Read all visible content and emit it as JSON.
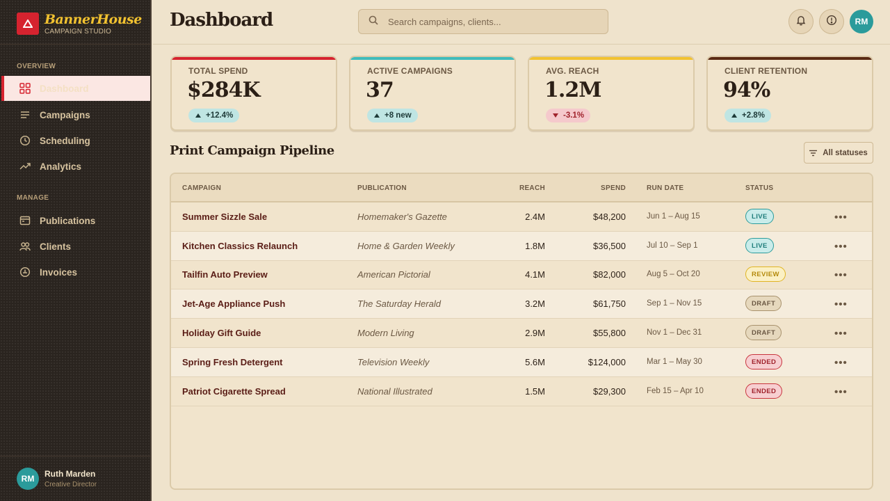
{
  "brand": {
    "name": "BannerHouse",
    "subtitle": "CAMPAIGN STUDIO"
  },
  "sidebar": {
    "sections": [
      {
        "label": "OVERVIEW"
      },
      {
        "label": "MANAGE"
      }
    ],
    "overview_items": [
      {
        "label": "Dashboard",
        "icon": "grid-icon",
        "active": true
      },
      {
        "label": "Campaigns",
        "icon": "list-icon"
      },
      {
        "label": "Scheduling",
        "icon": "clock-icon"
      },
      {
        "label": "Analytics",
        "icon": "trend-icon"
      }
    ],
    "manage_items": [
      {
        "label": "Publications",
        "icon": "publication-icon"
      },
      {
        "label": "Clients",
        "icon": "users-icon"
      },
      {
        "label": "Invoices",
        "icon": "coin-icon"
      }
    ],
    "user": {
      "initials": "RM",
      "name": "Ruth Marden",
      "role": "Creative Director"
    }
  },
  "header": {
    "title": "Dashboard",
    "search_placeholder": "Search campaigns, clients...",
    "avatar_initials": "RM"
  },
  "colors": {
    "brand_red": "#d6232f",
    "teal": "#2b9b9b",
    "mustard": "#f2c230",
    "brown": "#5a2a14"
  },
  "stats": [
    {
      "label": "TOTAL SPEND",
      "value": "$284K",
      "change": "+12.4%",
      "trend": "up",
      "accent": "#d6232f"
    },
    {
      "label": "ACTIVE CAMPAIGNS",
      "value": "37",
      "change": "+8 new",
      "trend": "up",
      "accent": "#3fbcbc"
    },
    {
      "label": "AVG. REACH",
      "value": "1.2M",
      "change": "-3.1%",
      "trend": "down",
      "accent": "#f2c230"
    },
    {
      "label": "CLIENT RETENTION",
      "value": "94%",
      "change": "+2.8%",
      "trend": "up",
      "accent": "#5a2a14"
    }
  ],
  "pipeline": {
    "title": "Print Campaign Pipeline",
    "filter_label": "All statuses",
    "columns": [
      "CAMPAIGN",
      "PUBLICATION",
      "REACH",
      "SPEND",
      "RUN DATE",
      "STATUS"
    ],
    "rows": [
      {
        "campaign": "Summer Sizzle Sale",
        "publication": "Homemaker's Gazette",
        "reach": "2.4M",
        "spend": "$48,200",
        "run_date": "Jun 1 – Aug 15",
        "status": "LIVE"
      },
      {
        "campaign": "Kitchen Classics Relaunch",
        "publication": "Home & Garden Weekly",
        "reach": "1.8M",
        "spend": "$36,500",
        "run_date": "Jul 10 – Sep 1",
        "status": "LIVE"
      },
      {
        "campaign": "Tailfin Auto Preview",
        "publication": "American Pictorial",
        "reach": "4.1M",
        "spend": "$82,000",
        "run_date": "Aug 5 – Oct 20",
        "status": "REVIEW"
      },
      {
        "campaign": "Jet-Age Appliance Push",
        "publication": "The Saturday Herald",
        "reach": "3.2M",
        "spend": "$61,750",
        "run_date": "Sep 1 – Nov 15",
        "status": "DRAFT"
      },
      {
        "campaign": "Holiday Gift Guide",
        "publication": "Modern Living",
        "reach": "2.9M",
        "spend": "$55,800",
        "run_date": "Nov 1 – Dec 31",
        "status": "DRAFT"
      },
      {
        "campaign": "Spring Fresh Detergent",
        "publication": "Television Weekly",
        "reach": "5.6M",
        "spend": "$124,000",
        "run_date": "Mar 1 – May 30",
        "status": "ENDED"
      },
      {
        "campaign": "Patriot Cigarette Spread",
        "publication": "National Illustrated",
        "reach": "1.5M",
        "spend": "$29,300",
        "run_date": "Feb 15 – Apr 10",
        "status": "ENDED"
      }
    ]
  }
}
